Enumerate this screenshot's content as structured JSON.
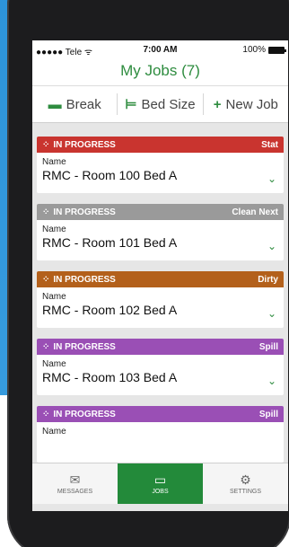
{
  "status_bar": {
    "carrier": "●●●●● Tele ᯤ",
    "time": "7:00 AM",
    "battery": "100%"
  },
  "header": {
    "title": "My Jobs (7)"
  },
  "toolbar": {
    "items": [
      {
        "label": "Break",
        "icon": "cup-icon"
      },
      {
        "label": "Bed Size",
        "icon": "bed-icon"
      },
      {
        "label": "New Job",
        "icon": "plus-icon"
      }
    ]
  },
  "jobs": [
    {
      "status": "IN PROGRESS",
      "tag": "Stat",
      "color": "#c9342f",
      "name_label": "Name",
      "name": "RMC - Room 100 Bed A"
    },
    {
      "status": "IN PROGRESS",
      "tag": "Clean Next",
      "color": "#9a9a9a",
      "name_label": "Name",
      "name": "RMC - Room 101 Bed A"
    },
    {
      "status": "IN PROGRESS",
      "tag": "Dirty",
      "color": "#b3601b",
      "name_label": "Name",
      "name": "RMC - Room 102 Bed A"
    },
    {
      "status": "IN PROGRESS",
      "tag": "Spill",
      "color": "#9a4fb5",
      "name_label": "Name",
      "name": "RMC - Room 103 Bed A"
    },
    {
      "status": "IN PROGRESS",
      "tag": "Spill",
      "color": "#9a4fb5",
      "name_label": "Name",
      "name": ""
    }
  ],
  "tabbar": {
    "tabs": [
      {
        "label": "MESSAGES",
        "icon": "envelope-icon",
        "active": false
      },
      {
        "label": "JOBS",
        "icon": "inbox-icon",
        "active": true
      },
      {
        "label": "SETTINGS",
        "icon": "gear-icon",
        "active": false
      }
    ]
  }
}
